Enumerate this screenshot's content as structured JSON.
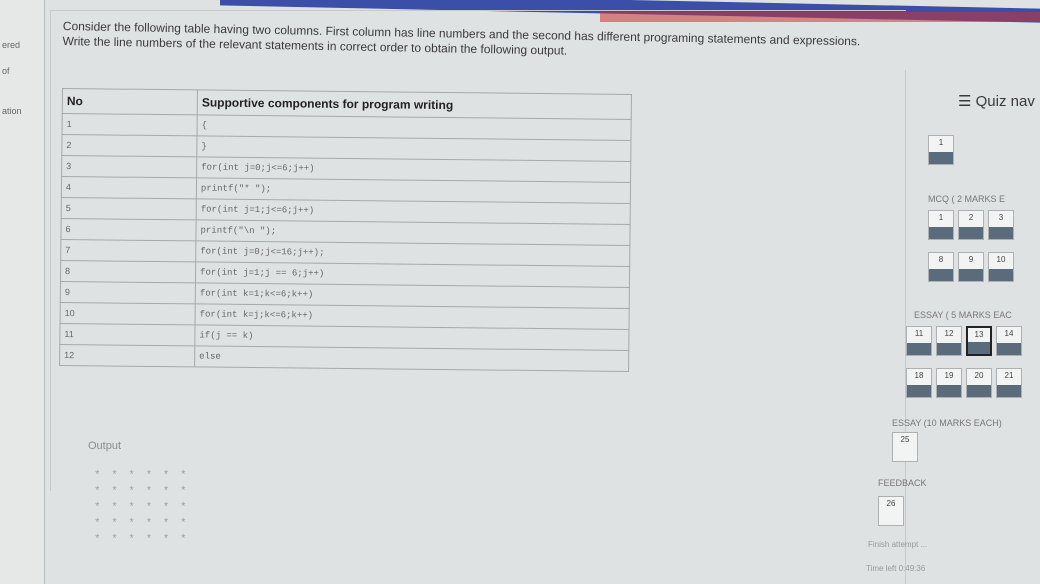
{
  "leftnav": {
    "items": [
      "ered",
      "of",
      "ation"
    ]
  },
  "question": {
    "text": "Consider the following table having two columns. First column has line numbers and the second has different programing statements and expressions. Write the line numbers of the relevant statements in correct order to obtain the following output.",
    "table": {
      "headers": [
        "No",
        "Supportive components for program writing"
      ],
      "rows": [
        [
          "1",
          "{"
        ],
        [
          "2",
          "}"
        ],
        [
          "3",
          "for(int j=0;j<=6;j++)"
        ],
        [
          "4",
          "printf(\"* \");"
        ],
        [
          "5",
          "for(int j=1;j<=6;j++)"
        ],
        [
          "6",
          "printf(\"\\n \");"
        ],
        [
          "7",
          "for(int j=0;j<=16;j++);"
        ],
        [
          "8",
          "for(int j=1;j == 6;j++)"
        ],
        [
          "9",
          "for(int k=1;k<=6;k++)"
        ],
        [
          "10",
          "for(int k=j;k<=6;k++)"
        ],
        [
          "11",
          "if(j == k)"
        ],
        [
          "12",
          "else"
        ]
      ]
    },
    "output_label": "Output",
    "output_lines": [
      "* * * * * *",
      "* * * * * *",
      "* * * * * *",
      "* * * * * *",
      "* * * * * *"
    ]
  },
  "quiz_nav": {
    "title": "Quiz nav",
    "sections": [
      {
        "label": "",
        "buttons": [
          "1"
        ]
      },
      {
        "label": "MCQ ( 2 MARKS E",
        "buttons": [
          "1",
          "2",
          "3",
          "8",
          "9",
          "10"
        ]
      },
      {
        "label": "ESSAY ( 5 MARKS EAC",
        "buttons": [
          "11",
          "12",
          "13",
          "14",
          "18",
          "19",
          "20",
          "21"
        ]
      },
      {
        "label": "ESSAY (10 MARKS EACH)",
        "buttons": [
          "25"
        ]
      },
      {
        "label": "FEEDBACK",
        "buttons": [
          "26"
        ]
      }
    ],
    "finish_label": "Finish attempt ...",
    "time_left": "Time left 0:49:36"
  }
}
